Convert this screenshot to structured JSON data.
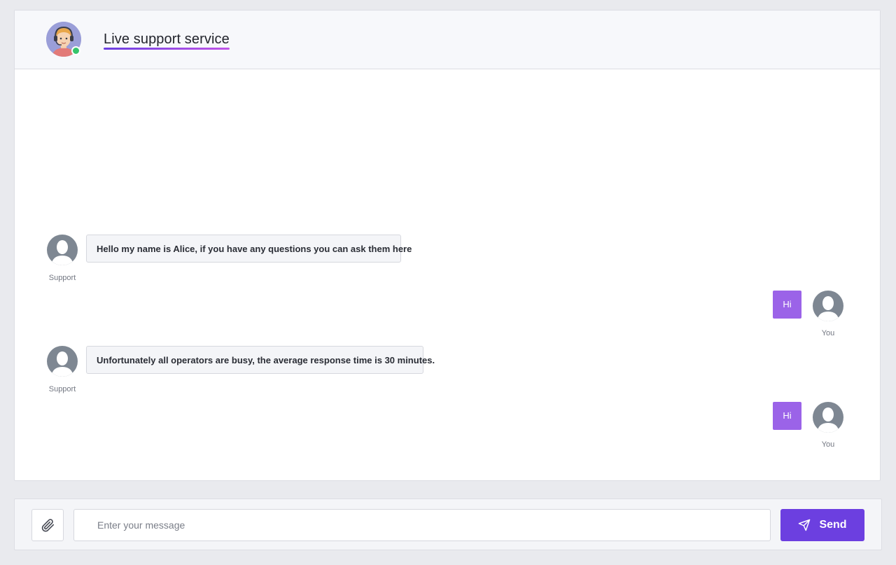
{
  "header": {
    "title": "Live support service",
    "agent_status": "online"
  },
  "messages": [
    {
      "sender": "support",
      "label": "Support",
      "text": "Hello my name is Alice, if you have any questions you can ask them here"
    },
    {
      "sender": "you",
      "label": "You",
      "text": "Hi"
    },
    {
      "sender": "support",
      "label": "Support",
      "text": "Unfortunately all operators are busy, the average response time is 30 minutes."
    },
    {
      "sender": "you",
      "label": "You",
      "text": "Hi"
    }
  ],
  "composer": {
    "placeholder": "Enter your message",
    "value": "",
    "send_label": "Send"
  },
  "icons": {
    "attach": "paperclip-icon",
    "send": "paper-plane-icon",
    "agent_avatar": "support-agent-avatar",
    "user_avatar": "user-silhouette-icon"
  },
  "colors": {
    "accent": "#6c3fe0",
    "outgoing_bubble": "#9b63e8",
    "online": "#36c46b"
  }
}
